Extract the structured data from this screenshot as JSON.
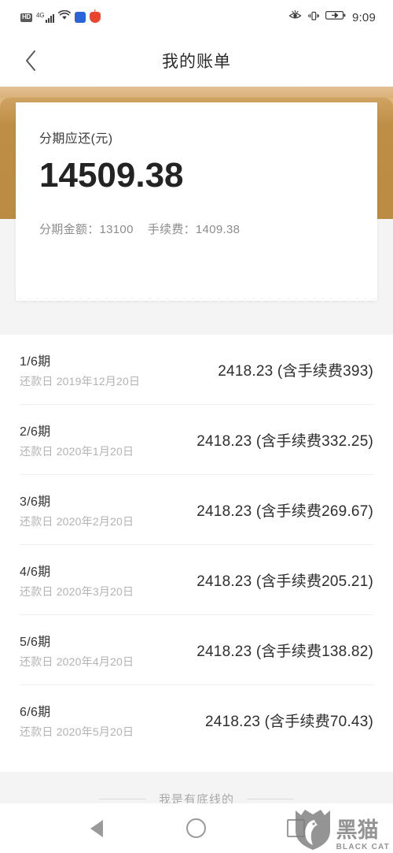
{
  "status_bar": {
    "hd_label": "HD",
    "network_label": "4G",
    "signal_icon": "signal-bars-icon",
    "wifi_icon": "wifi-icon",
    "app_icon_1": "blue-app-icon",
    "app_icon_2": "red-app-icon",
    "eye_icon": "eye-comfort-icon",
    "vibrate_icon": "vibrate-icon",
    "battery_icon": "battery-charging-icon",
    "time": "9:09"
  },
  "title_bar": {
    "back_icon": "chevron-left-icon",
    "title": "我的账单"
  },
  "summary_card": {
    "label": "分期应还(元)",
    "amount": "14509.38",
    "principal_label": "分期金额：13100",
    "fee_label": "手续费：1409.38",
    "accent_color": "#be8e46",
    "accent_light_color": "#ddb77e"
  },
  "installments": [
    {
      "term": "1/6期",
      "date": "还款日 2019年12月20日",
      "amount": "2418.23 (含手续费393)"
    },
    {
      "term": "2/6期",
      "date": "还款日 2020年1月20日",
      "amount": "2418.23 (含手续费332.25)"
    },
    {
      "term": "3/6期",
      "date": "还款日 2020年2月20日",
      "amount": "2418.23 (含手续费269.67)"
    },
    {
      "term": "4/6期",
      "date": "还款日 2020年3月20日",
      "amount": "2418.23 (含手续费205.21)"
    },
    {
      "term": "5/6期",
      "date": "还款日 2020年4月20日",
      "amount": "2418.23 (含手续费138.82)"
    },
    {
      "term": "6/6期",
      "date": "还款日 2020年5月20日",
      "amount": "2418.23 (含手续费70.43)"
    }
  ],
  "footer": {
    "end_text": "我是有底线的"
  },
  "nav_bar": {
    "back_icon": "nav-back-triangle-icon",
    "home_icon": "nav-home-circle-icon",
    "recents_icon": "nav-recents-square-icon"
  },
  "watermark": {
    "shield_icon": "black-cat-shield-icon",
    "cn_text": "黑猫",
    "en_text": "BLACK CAT"
  }
}
